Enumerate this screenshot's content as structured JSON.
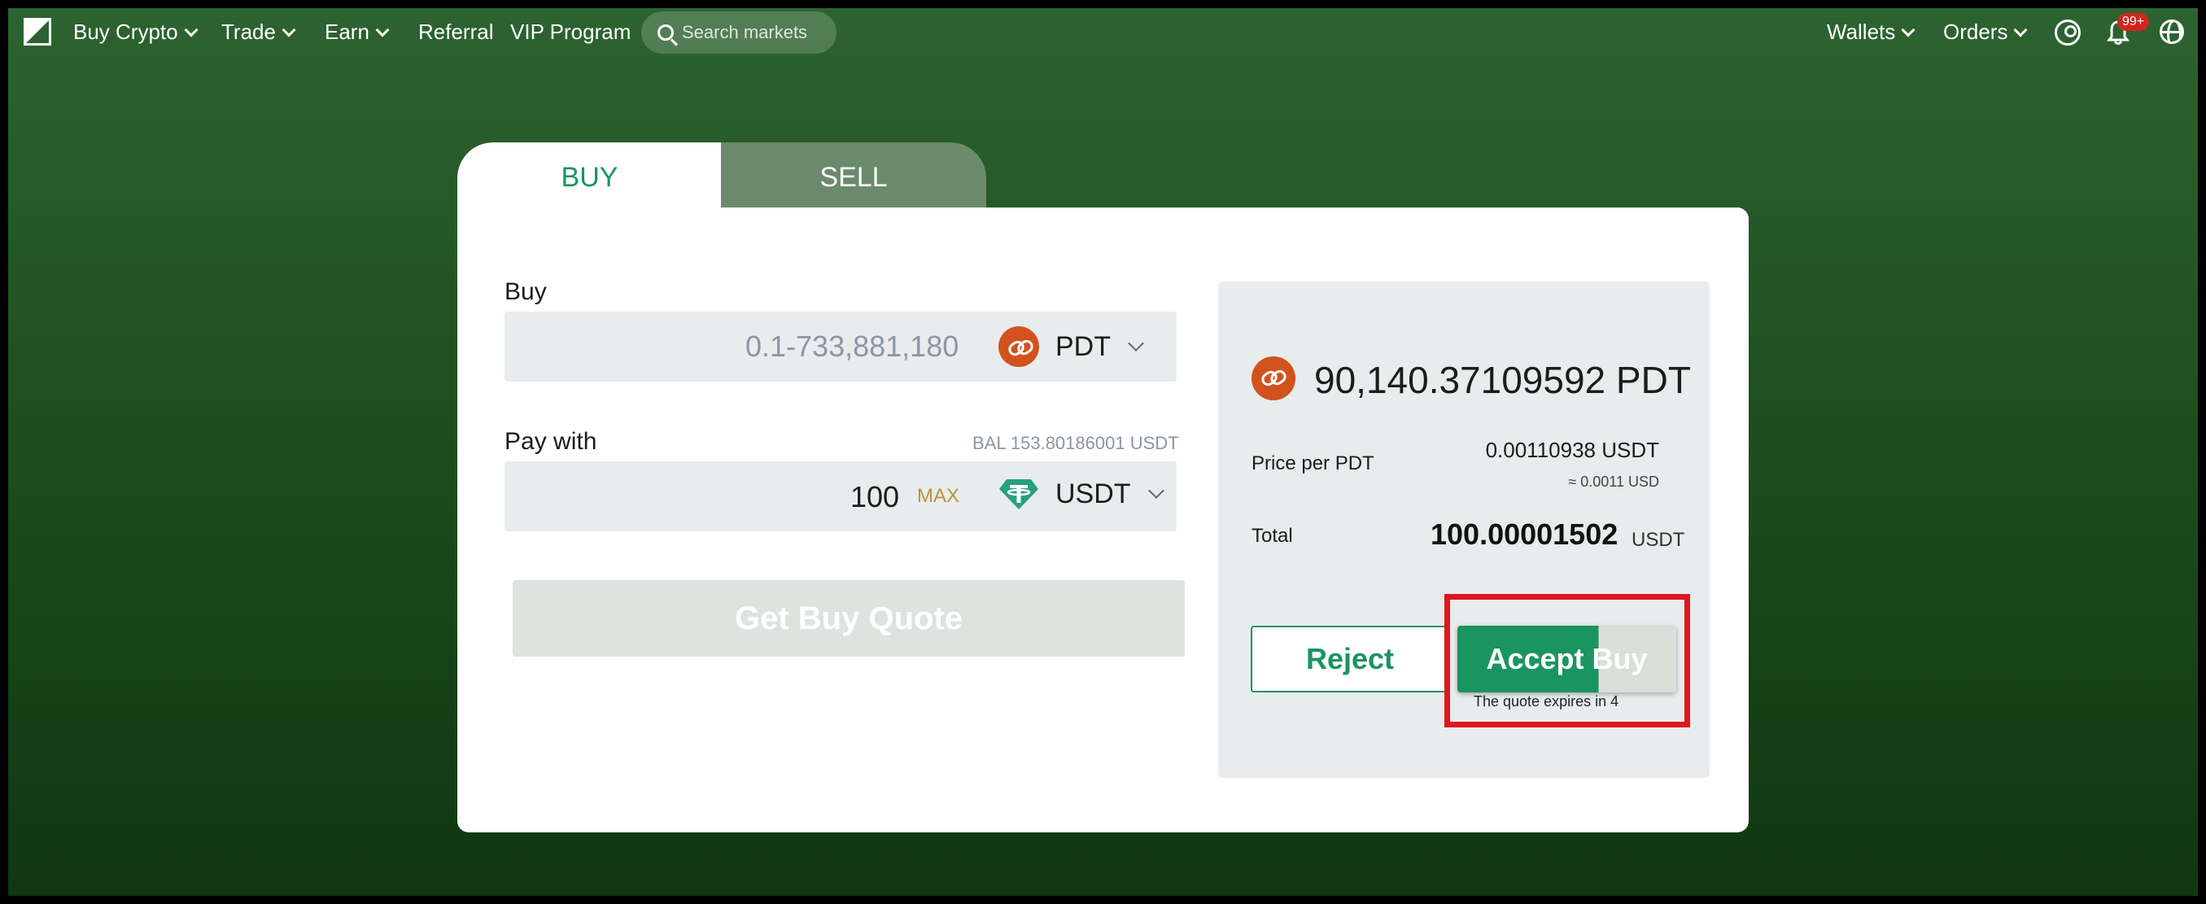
{
  "nav": {
    "items": [
      {
        "label": "Buy Crypto",
        "dropdown": true
      },
      {
        "label": "Trade",
        "dropdown": true
      },
      {
        "label": "Earn",
        "dropdown": true
      },
      {
        "label": "Referral",
        "dropdown": false
      },
      {
        "label": "VIP Program",
        "dropdown": false
      }
    ],
    "search_placeholder": "Search markets",
    "right_items": [
      {
        "label": "Wallets",
        "dropdown": true
      },
      {
        "label": "Orders",
        "dropdown": true
      }
    ],
    "notification_badge": "99+",
    "icons": [
      "logo-icon",
      "search-icon",
      "user-icon",
      "bell-icon",
      "globe-icon"
    ]
  },
  "tabs": {
    "buy": "BUY",
    "sell": "SELL",
    "active": "BUY"
  },
  "buy_field": {
    "label": "Buy",
    "placeholder": "0.1-733,881,180",
    "asset": "PDT"
  },
  "pay_field": {
    "label": "Pay with",
    "balance": "BAL 153.80186001 USDT",
    "value": "100",
    "max_label": "MAX",
    "asset": "USDT"
  },
  "quote_button": "Get Buy Quote",
  "quote": {
    "amount": "90,140.37109592 PDT",
    "price_label": "Price per PDT",
    "price_value": "0.00110938 USDT",
    "price_approx": "≈ 0.0011 USD",
    "total_label": "Total",
    "total_value": "100.00001502",
    "total_unit": "USDT",
    "reject_label": "Reject",
    "accept_label": "Accept Buy",
    "expiry_text": "The quote expires in 4",
    "accept_progress": 0.645
  },
  "colors": {
    "accent": "#1a9460",
    "pdt_coin": "#d2521e",
    "usdt_coin": "#26a17b",
    "highlight": "#e0151e"
  }
}
